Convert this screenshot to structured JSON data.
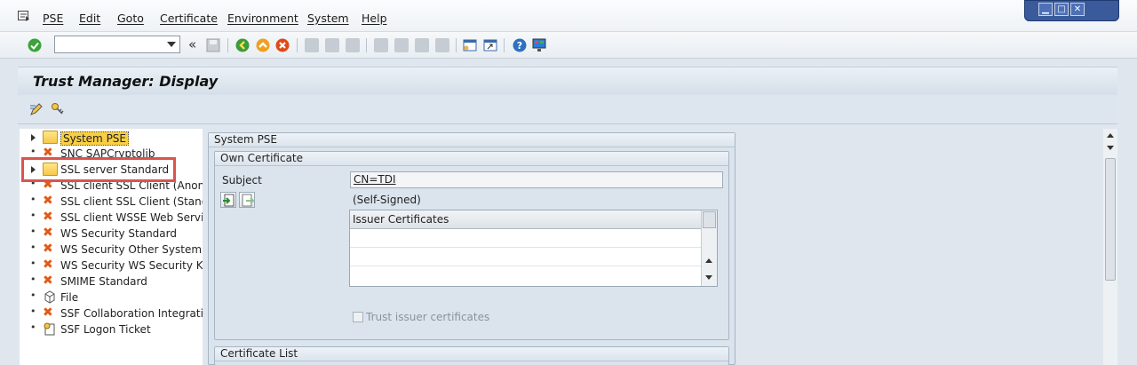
{
  "menu": [
    "PSE",
    "Edit",
    "Goto",
    "Certificate",
    "Environment",
    "System",
    "Help"
  ],
  "window_controls": [
    "minimize-icon",
    "maximize-icon",
    "close-icon"
  ],
  "toolbar": {
    "command_field_value": "",
    "icons": [
      "enter-icon",
      "command-dropdown-icon",
      "collapse-icon",
      "save-icon",
      "back-icon",
      "exit-icon",
      "cancel-icon",
      "print-icon",
      "find-icon",
      "find-next-icon",
      "first-page-icon",
      "previous-page-icon",
      "next-page-icon",
      "last-page-icon",
      "create-session-icon",
      "shortcut-icon",
      "help-icon",
      "layout-icon"
    ]
  },
  "title": "Trust Manager: Display",
  "app_toolbar_icons": [
    "edit-icon",
    "key-icon"
  ],
  "tree": [
    {
      "label": "System PSE",
      "icon": "folder-icon",
      "expandable": true,
      "selected": true
    },
    {
      "label": "SNC SAPCryptolib",
      "icon": "x-icon",
      "expandable": false
    },
    {
      "label": "SSL server Standard",
      "icon": "folder-icon",
      "expandable": true,
      "highlighted": true
    },
    {
      "label": "SSL client SSL Client (Anonym",
      "icon": "x-icon",
      "expandable": false
    },
    {
      "label": "SSL client SSL Client (Standa",
      "icon": "x-icon",
      "expandable": false
    },
    {
      "label": "SSL client WSSE Web Servic",
      "icon": "x-icon",
      "expandable": false
    },
    {
      "label": "WS Security Standard",
      "icon": "x-icon",
      "expandable": false
    },
    {
      "label": "WS Security Other System E",
      "icon": "x-icon",
      "expandable": false
    },
    {
      "label": "WS Security WS Security Key",
      "icon": "x-icon",
      "expandable": false
    },
    {
      "label": "SMIME Standard",
      "icon": "x-icon",
      "expandable": false
    },
    {
      "label": "File",
      "icon": "file-icon",
      "expandable": false
    },
    {
      "label": "SSF Collaboration Integration",
      "icon": "x-icon",
      "expandable": false
    },
    {
      "label": "SSF Logon Ticket",
      "icon": "ticket-icon",
      "expandable": false
    }
  ],
  "system_pse": {
    "group_title": "System PSE",
    "own_certificate_title": "Own Certificate",
    "subject_label": "Subject",
    "subject_value": "CN=TDI",
    "self_signed": "(Self-Signed)",
    "issuer_header": "Issuer Certificates",
    "issuer_rows": [
      "",
      "",
      ""
    ],
    "trust_label": "Trust issuer certificates",
    "trust_checked": false,
    "cert_list_title": "Certificate List"
  },
  "colors": {
    "highlight": "#d9534f",
    "selected": "#f8cf43",
    "folder": "#f6c84a",
    "error_x": "#e05a18"
  }
}
